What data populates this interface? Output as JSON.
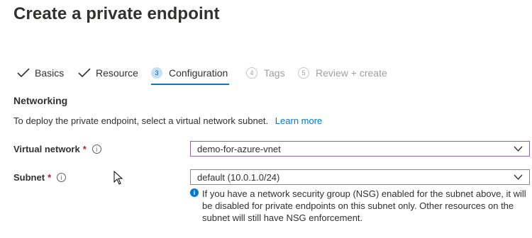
{
  "page": {
    "title": "Create a private endpoint"
  },
  "tabs": [
    {
      "label": "Basics",
      "state": "completed",
      "icon": "checkmark-icon"
    },
    {
      "label": "Resource",
      "state": "completed",
      "icon": "checkmark-icon"
    },
    {
      "label": "Configuration",
      "number": "3",
      "state": "active"
    },
    {
      "label": "Tags",
      "number": "4",
      "state": "disabled"
    },
    {
      "label": "Review + create",
      "number": "5",
      "state": "disabled"
    }
  ],
  "networking": {
    "heading": "Networking",
    "description": "To deploy the private endpoint, select a virtual network subnet.",
    "learn_more": "Learn more"
  },
  "fields": {
    "virtual_network": {
      "label": "Virtual network",
      "required_mark": "*",
      "value": "demo-for-azure-vnet"
    },
    "subnet": {
      "label": "Subnet",
      "required_mark": "*",
      "value": "default (10.0.1.0/24)"
    }
  },
  "info_note": "If you have a network security group (NSG) enabled for the subnet above, it will be disabled for private endpoints on this subnet only. Other resources on the subnet will still have NSG enforcement.",
  "colors": {
    "accent": "#0078d4",
    "required": "#a4262c",
    "focus_border": "#8764b8"
  }
}
